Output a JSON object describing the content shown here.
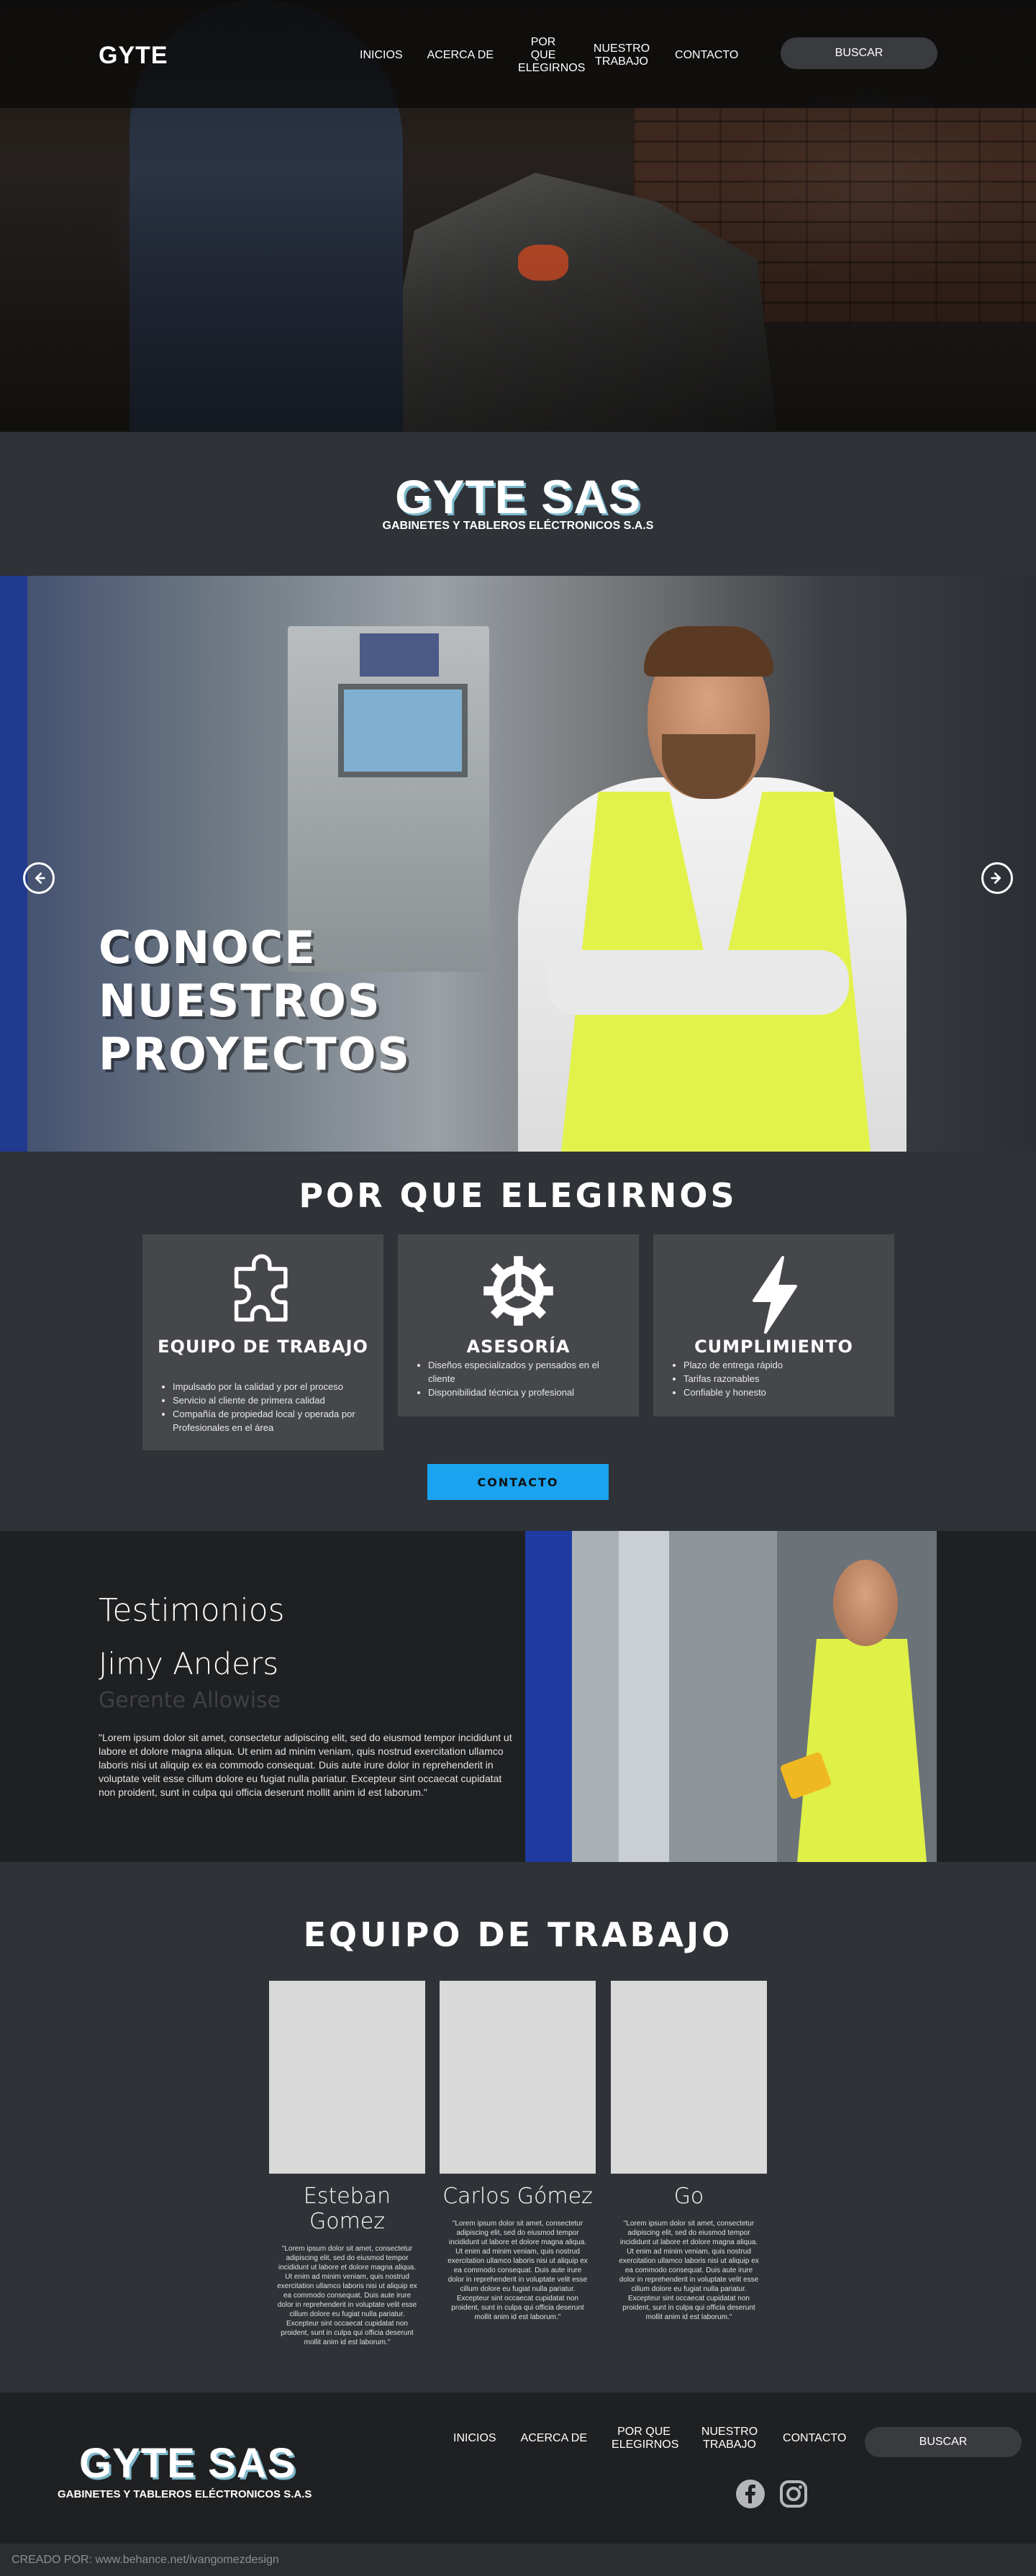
{
  "nav": {
    "logo": "GYTE",
    "links": [
      "INICIOS",
      "ACERCA DE",
      "POR QUE ELEGIRNOS",
      "NUESTRO TRABAJO",
      "CONTACTO"
    ],
    "search_label": "BUSCAR"
  },
  "brand": {
    "title": "GYTE SAS",
    "subtitle": "GABINETES Y TABLEROS ELÉCTRONICOS S.A.S"
  },
  "carousel": {
    "title_lines": [
      "CONOCE",
      "NUESTROS",
      "PROYECTOS"
    ],
    "prev_icon": "arrow-left-circle-icon",
    "next_icon": "arrow-right-circle-icon"
  },
  "why": {
    "heading": "POR QUE ELEGIRNOS",
    "cards": [
      {
        "icon": "puzzle-icon",
        "title": "EQUIPO DE TRABAJO",
        "items": [
          "Impulsado por la calidad y por el proceso",
          "Servicio al cliente de primera calidad",
          "Compañía de propiedad local y operada por Profesionales en el área"
        ]
      },
      {
        "icon": "gear-icon",
        "title": "ASESORÍA",
        "items": [
          "Diseños especializados y pensados en el cliente",
          "Disponibilidad técnica y profesional"
        ]
      },
      {
        "icon": "lightning-icon",
        "title": "CUMPLIMIENTO",
        "items": [
          "Plazo de entrega rápido",
          "Tarifas razonables",
          "Confiable y honesto"
        ]
      }
    ],
    "contact_label": "CONTACTO",
    "contact_color": "#1aa3ef"
  },
  "testimonials": {
    "title": "Testimonios",
    "name": "Jimy Anders",
    "role": "Gerente Allowise",
    "quote": "\"Lorem ipsum dolor sit amet, consectetur adipiscing elit, sed do eiusmod tempor incididunt ut labore et dolore magna aliqua. Ut enim ad minim veniam, quis nostrud exercitation ullamco laboris nisi ut aliquip ex ea commodo consequat. Duis aute irure dolor in reprehenderit in voluptate velit esse cillum dolore eu fugiat nulla pariatur. Excepteur sint occaecat cupidatat non proident, sunt in culpa qui officia deserunt mollit anim id est laborum.\""
  },
  "team": {
    "heading": "EQUIPO DE TRABAJO",
    "members": [
      {
        "name": "Esteban Gomez",
        "text": "\"Lorem ipsum dolor sit amet, consectetur adipiscing elit, sed do eiusmod tempor incididunt ut labore et dolore magna aliqua. Ut enim ad minim veniam, quis nostrud exercitation ullamco laboris nisi ut aliquip ex ea commodo consequat. Duis aute irure dolor in reprehenderit in voluptate velit esse cillum dolore eu fugiat nulla pariatur. Excepteur sint occaecat cupidatat non proident, sunt in culpa qui officia deserunt mollit anim id est laborum.\""
      },
      {
        "name": "Carlos Gómez",
        "text": "\"Lorem ipsum dolor sit amet, consectetur adipiscing elit, sed do eiusmod tempor incididunt ut labore et dolore magna aliqua. Ut enim ad minim veniam, quis nostrud exercitation ullamco laboris nisi ut aliquip ex ea commodo consequat. Duis aute irure dolor in reprehenderit in voluptate velit esse cillum dolore eu fugiat nulla pariatur. Excepteur sint occaecat cupidatat non proident, sunt in culpa qui officia deserunt mollit anim id est laborum.\""
      },
      {
        "name": "Go",
        "text": "\"Lorem ipsum dolor sit amet, consectetur adipiscing elit, sed do eiusmod tempor incididunt ut labore et dolore magna aliqua. Ut enim ad minim veniam, quis nostrud exercitation ullamco laboris nisi ut aliquip ex ea commodo consequat. Duis aute irure dolor in reprehenderit in voluptate velit esse cillum dolore eu fugiat nulla pariatur. Excepteur sint occaecat cupidatat non proident, sunt in culpa qui officia deserunt mollit anim id est laborum.\""
      }
    ]
  },
  "footer": {
    "brand": "GYTE SAS",
    "subtitle": "GABINETES Y TABLEROS ELÉCTRONICOS S.A.S",
    "links": [
      "INICIOS",
      "ACERCA DE",
      "POR QUE ELEGIRNOS",
      "NUESTRO TRABAJO",
      "CONTACTO"
    ],
    "search_label": "BUSCAR",
    "social_icons": [
      "facebook-icon",
      "instagram-icon"
    ]
  },
  "credit": "CREADO POR: www.behance.net/ivangomezdesign"
}
